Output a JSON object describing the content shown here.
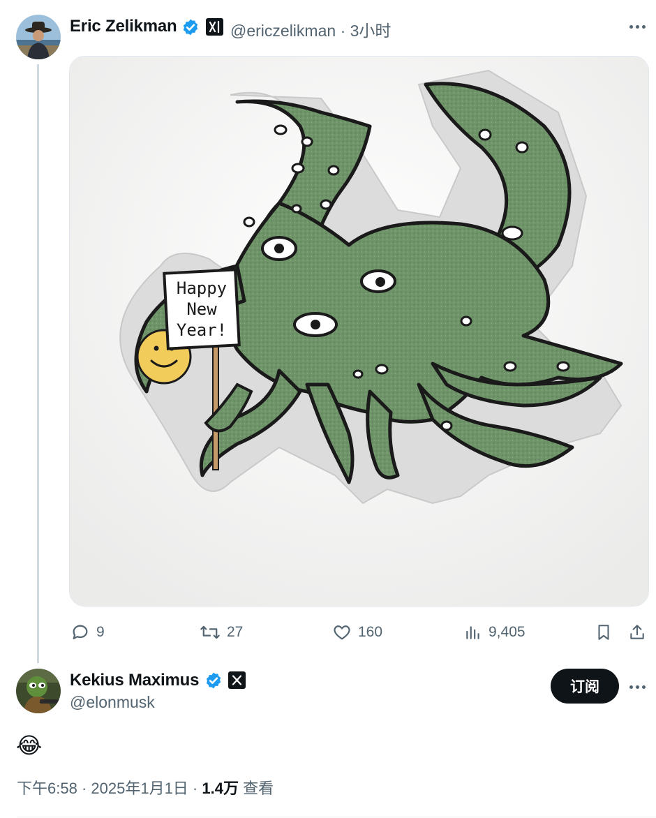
{
  "tweet": {
    "author_name": "Eric Zelikman",
    "handle": "@ericzelikman",
    "separator": "·",
    "time": "3小时",
    "verified_icon": "verified-badge-icon",
    "affiliate_icon": "xai-logo-icon",
    "media": {
      "sign_lines": [
        "Happy",
        "New",
        "Year!"
      ]
    },
    "stats": {
      "replies": "9",
      "retweets": "27",
      "likes": "160",
      "views": "9,405"
    }
  },
  "reply": {
    "author_name": "Kekius Maximus",
    "handle": "@elonmusk",
    "affiliate_icon": "x-logo-icon",
    "subscribe_label": "订阅",
    "text": "😂",
    "meta": {
      "time": "下午6:58",
      "sep1": " · ",
      "date": "2025年1月1日",
      "sep2": " · ",
      "views_count": "1.4万",
      "views_label": " 查看"
    }
  },
  "colors": {
    "verified": "#1d9bf0",
    "text_primary": "#0f1419",
    "text_secondary": "#536471",
    "octopus_green": "#6f9469"
  }
}
